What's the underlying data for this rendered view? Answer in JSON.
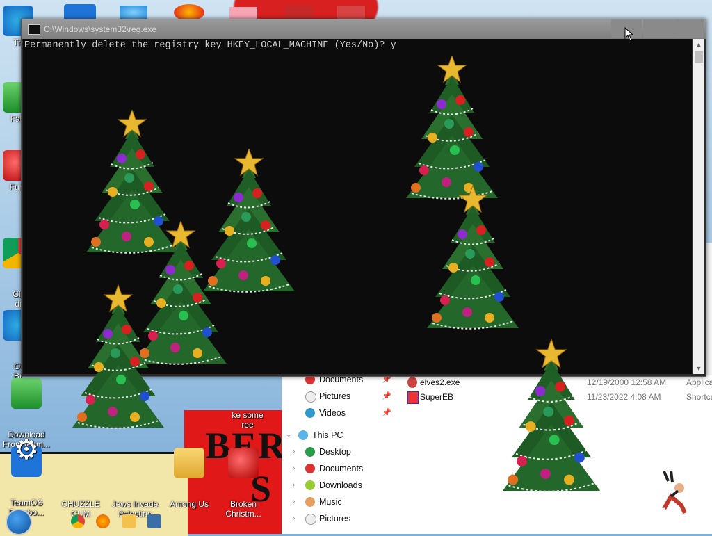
{
  "desktop": {
    "icons": [
      {
        "label": "Th",
        "icon": "teamviewer-icon"
      },
      {
        "label": "Falc",
        "icon": "falcon-icon"
      },
      {
        "label": "Furn",
        "icon": "furnace-icon"
      },
      {
        "label": "Gh\ndi",
        "icon": "chrome-icon"
      },
      {
        "label": "Ol\nBr",
        "icon": "browser-icon"
      },
      {
        "label": "Download\nFrom team...",
        "icon": "download-icon"
      },
      {
        "label": "TeamOS\nFacebo...",
        "icon": "gear-icon"
      },
      {
        "label": "CHUZZLE\nCUM",
        "icon": "chuzzle-icon"
      },
      {
        "label": "Jews Invade\nPalestine",
        "icon": "folder-icon"
      },
      {
        "label": "Among Us",
        "icon": "among-us-icon"
      },
      {
        "label": "Broken\nChristm...",
        "icon": "ornament-icon"
      },
      {
        "label": "ke some\nree",
        "icon": "christmas-icon"
      }
    ],
    "wallpaper_text_1": "BERN",
    "wallpaper_text_2": "S"
  },
  "cmd": {
    "title": "C:\\Windows\\system32\\reg.exe",
    "line": "Permanently delete the registry key HKEY_LOCAL_MACHINE (Yes/No)? y"
  },
  "explorer": {
    "quick_access": [
      {
        "label": "Documents",
        "pinned": true
      },
      {
        "label": "Pictures",
        "pinned": true
      },
      {
        "label": "Videos",
        "pinned": true
      }
    ],
    "this_pc": "This PC",
    "this_pc_items": [
      "Desktop",
      "Documents",
      "Downloads",
      "Music",
      "Pictures"
    ],
    "files": [
      {
        "name": "elves2.exe",
        "date": "12/19/2000 12:58 AM",
        "type": "Applica"
      },
      {
        "name": "SuperEB",
        "date": "11/23/2022 4:08 AM",
        "type": "Shortcu"
      }
    ]
  },
  "colors": {
    "cmd_bg": "#0c0c0c",
    "cmd_text": "#d0d0d0",
    "title_bar": "#8c8c8c"
  }
}
